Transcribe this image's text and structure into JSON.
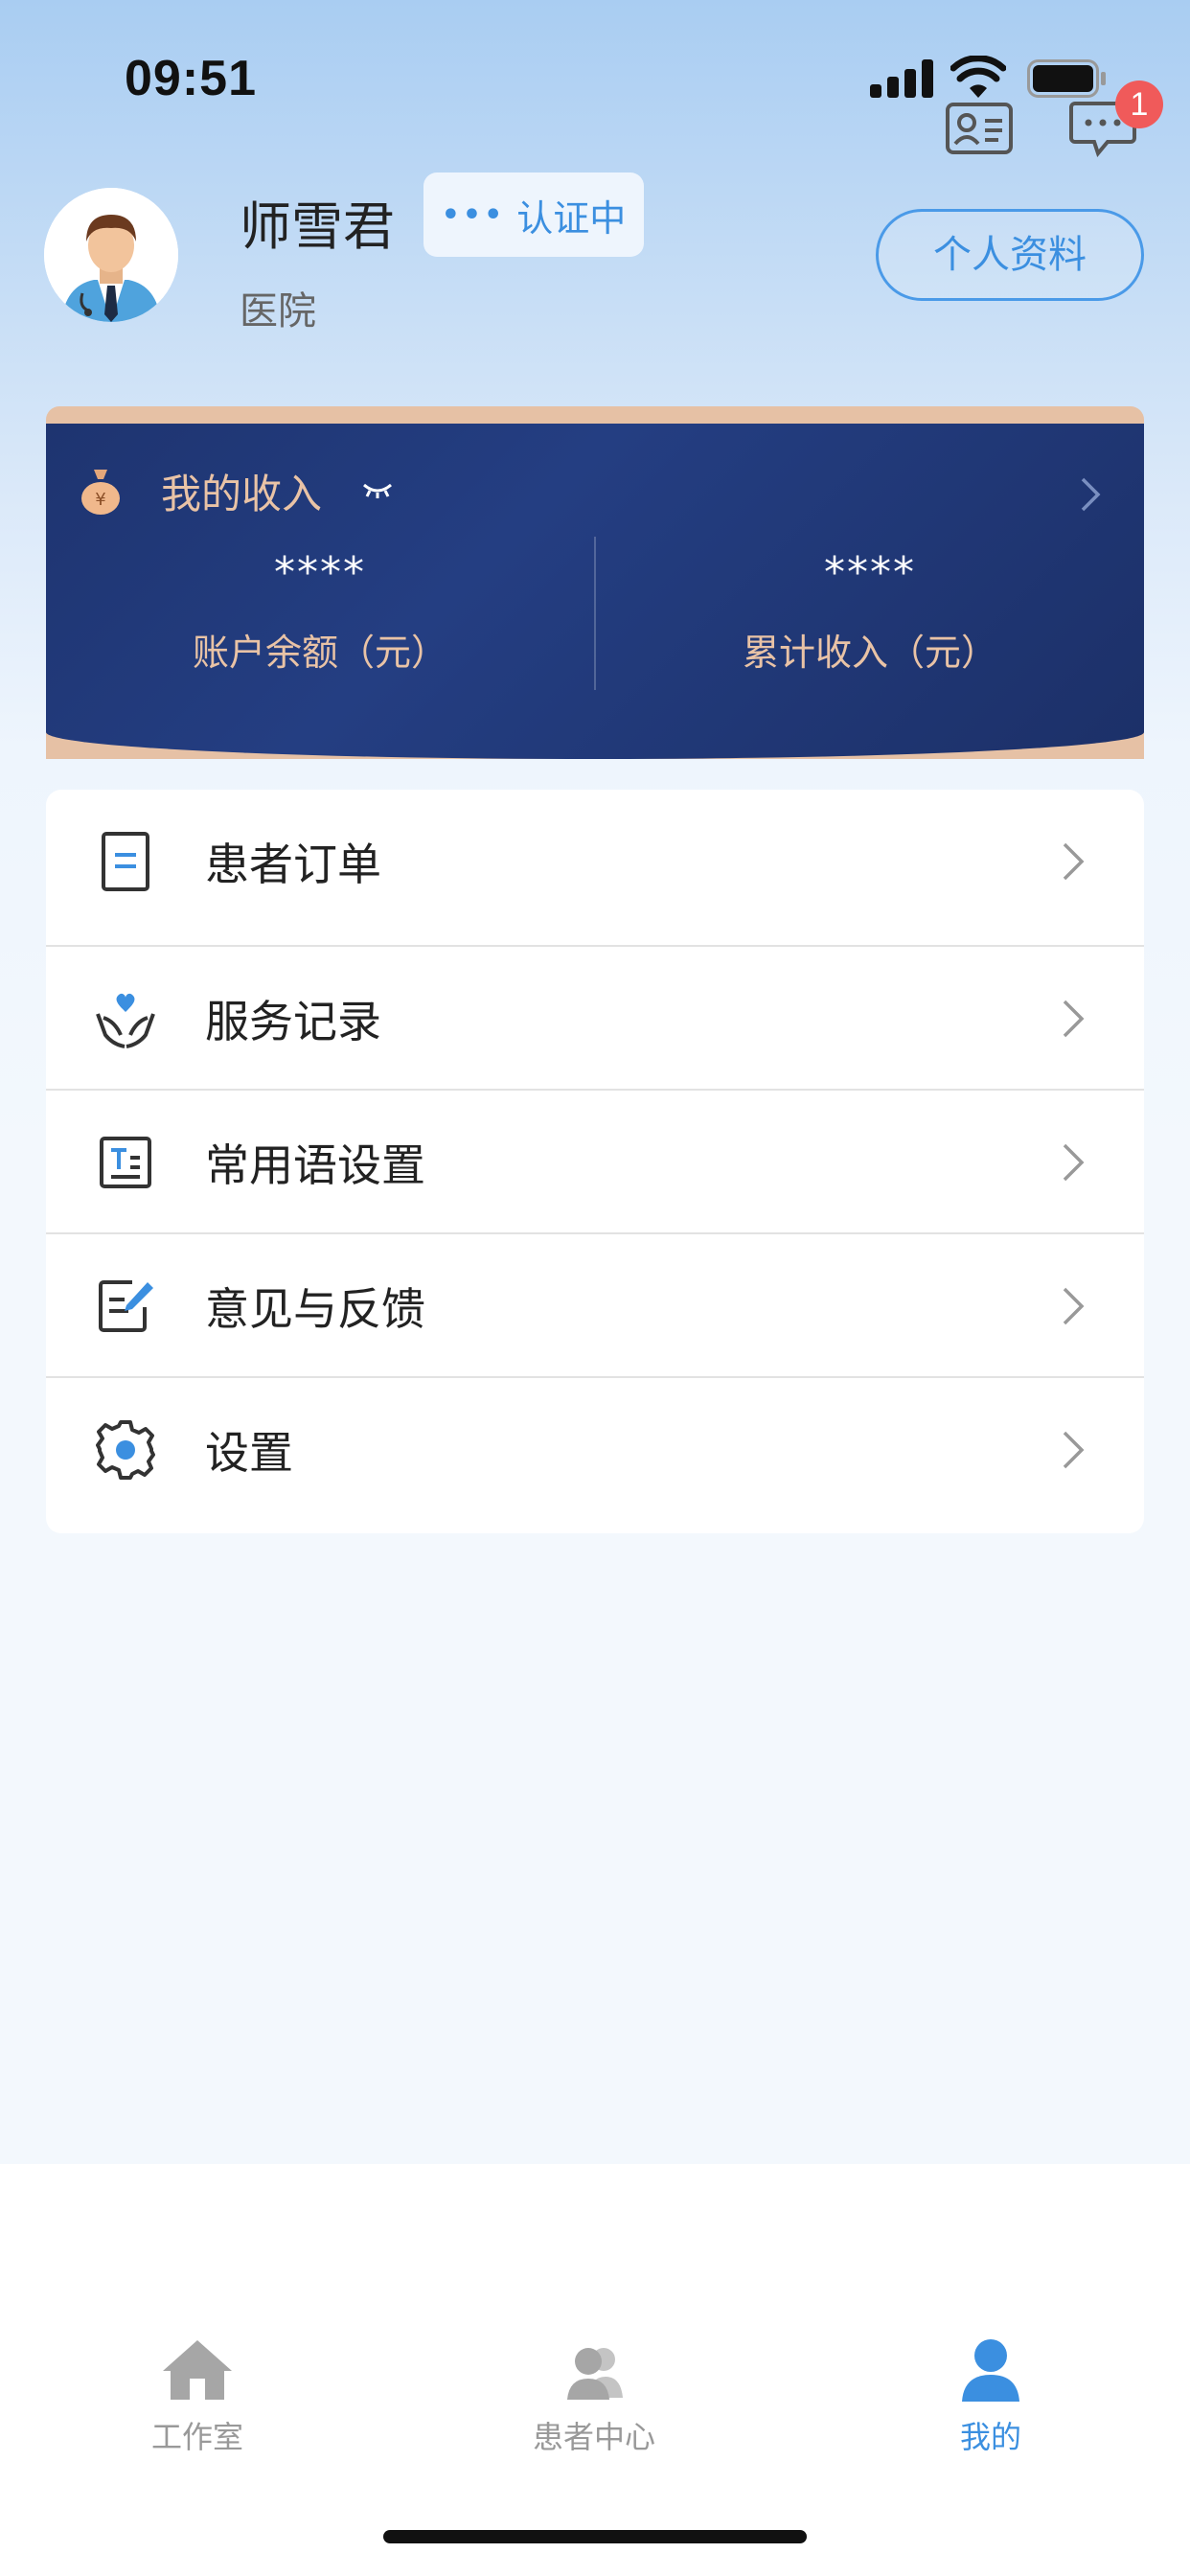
{
  "status_bar": {
    "time": "09:51"
  },
  "header_icons": {
    "message_badge_count": "1"
  },
  "profile": {
    "name": "师雪君",
    "cert_status": "认证中",
    "hospital": "医院",
    "profile_button": "个人资料"
  },
  "income": {
    "title": "我的收入",
    "balance_value": "****",
    "balance_label": "账户余额（元）",
    "total_value": "****",
    "total_label": "累计收入（元）"
  },
  "menu": {
    "items": [
      {
        "label": "患者订单",
        "icon": "document-icon"
      },
      {
        "label": "服务记录",
        "icon": "hands-heart-icon"
      },
      {
        "label": "常用语设置",
        "icon": "text-template-icon"
      },
      {
        "label": "意见与反馈",
        "icon": "edit-note-icon"
      },
      {
        "label": "设置",
        "icon": "gear-icon"
      }
    ]
  },
  "tabs": [
    {
      "label": "工作室",
      "icon": "home-icon",
      "active": false
    },
    {
      "label": "患者中心",
      "icon": "users-icon",
      "active": false
    },
    {
      "label": "我的",
      "icon": "person-icon",
      "active": true
    }
  ],
  "colors": {
    "accent": "#3b8fe0",
    "income_card": "#1e3470",
    "income_gold": "#e9c3a6",
    "badge": "#f05a5a"
  }
}
